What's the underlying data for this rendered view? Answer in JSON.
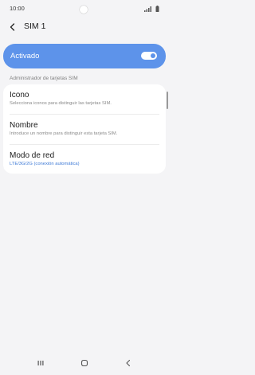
{
  "status_bar": {
    "time": "10:00"
  },
  "header": {
    "title": "SIM 1"
  },
  "toggle": {
    "label": "Activado",
    "state": "on"
  },
  "section": {
    "title": "Administrador de tarjetas SIM"
  },
  "items": [
    {
      "title": "Icono",
      "subtitle": "Selecciona iconos para distinguir las tarjetas SIM."
    },
    {
      "title": "Nombre",
      "subtitle": "Introduce un nombre para distinguir esta tarjeta SIM."
    },
    {
      "title": "Modo de red",
      "subtitle": "LTE/3G/2G (conexión automática)"
    }
  ],
  "colors": {
    "background": "#f4f4f6",
    "toggle_card": "#5d93ea",
    "accent_text": "#3e7ad6"
  },
  "icons": {
    "back": "arrow-left",
    "recents": "three-bars",
    "home": "rounded-square",
    "back_nav": "chevron-left"
  }
}
